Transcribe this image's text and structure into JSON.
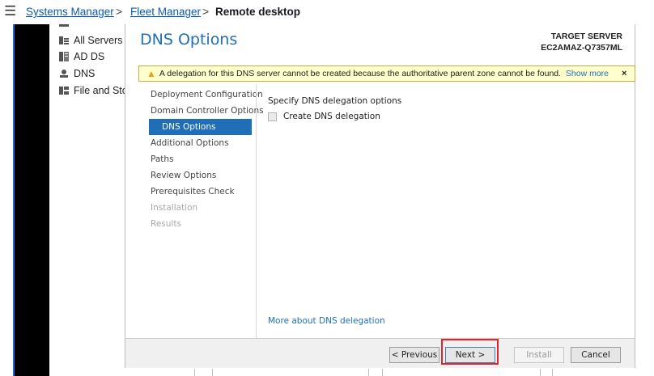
{
  "topbar": {
    "menu_icon": "hamburger-icon",
    "breadcrumb": {
      "item1": "Systems Manager",
      "item2": "Fleet Manager",
      "current": "Remote desktop",
      "separator": ">"
    }
  },
  "server_manager_nav": {
    "items": [
      {
        "label": "All Servers",
        "icon": "servers-icon"
      },
      {
        "label": "AD DS",
        "icon": "ad-ds-icon"
      },
      {
        "label": "DNS",
        "icon": "dns-icon"
      },
      {
        "label": "File and Sto",
        "icon": "file-storage-icon"
      }
    ]
  },
  "wizard": {
    "title": "DNS Options",
    "target_server_label": "TARGET SERVER",
    "target_server_name": "EC2AMAZ-Q7357ML",
    "warning": {
      "text": "A delegation for this DNS server cannot be created because the authoritative parent zone cannot be found...",
      "show_more": "Show more",
      "close": "×",
      "icon": "warning-icon"
    },
    "steps": [
      {
        "label": "Deployment Configuration",
        "state": "normal"
      },
      {
        "label": "Domain Controller Options",
        "state": "normal"
      },
      {
        "label": "DNS Options",
        "state": "active"
      },
      {
        "label": "Additional Options",
        "state": "normal"
      },
      {
        "label": "Paths",
        "state": "normal"
      },
      {
        "label": "Review Options",
        "state": "normal"
      },
      {
        "label": "Prerequisites Check",
        "state": "normal"
      },
      {
        "label": "Installation",
        "state": "disabled"
      },
      {
        "label": "Results",
        "state": "disabled"
      }
    ],
    "content_heading": "Specify DNS delegation options",
    "checkbox_label": "Create DNS delegation",
    "checkbox_checked": false,
    "more_link": "More about DNS delegation",
    "buttons": {
      "previous": "< Previous",
      "next": "Next >",
      "install": "Install",
      "cancel": "Cancel"
    }
  },
  "colors": {
    "accent": "#1e6fb8",
    "link": "#0b5bb5",
    "warning_bg": "#ffffcc",
    "highlight": "#e0242c"
  }
}
